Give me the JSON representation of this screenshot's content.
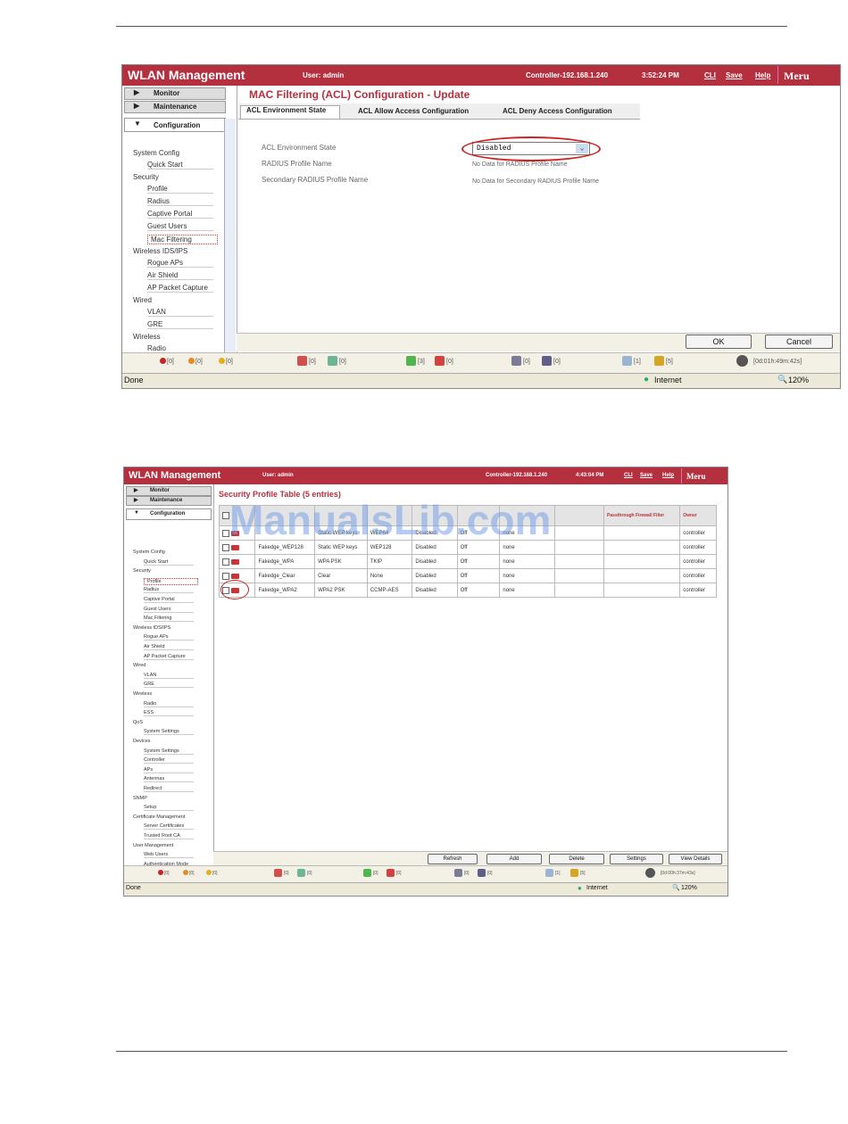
{
  "colors": {
    "accent": "#b5303f",
    "watermark": "#78a0e6"
  },
  "screenshot1": {
    "app_title": "WLAN Management",
    "user": "User: admin",
    "controller": "Controller-192.168.1.240",
    "time": "3:52:24 PM",
    "links": [
      "CLI",
      "Save",
      "Help"
    ],
    "logo": "Meru",
    "nav": {
      "monitor": "Monitor",
      "maintenance": "Maintenance",
      "configuration": "Configuration",
      "items": [
        {
          "label": "System Config",
          "group": true
        },
        {
          "label": "Quick Start"
        },
        {
          "label": "Security",
          "group": true
        },
        {
          "label": "Profile"
        },
        {
          "label": "Radius"
        },
        {
          "label": "Captive Portal"
        },
        {
          "label": "Guest Users"
        },
        {
          "label": "Mac Filtering",
          "selected": true
        },
        {
          "label": "Wireless IDS/IPS",
          "group": true
        },
        {
          "label": "Rogue APs"
        },
        {
          "label": "Air Shield"
        },
        {
          "label": "AP Packet Capture"
        },
        {
          "label": "Wired",
          "group": true
        },
        {
          "label": "VLAN"
        },
        {
          "label": "GRE"
        },
        {
          "label": "Wireless",
          "group": true
        },
        {
          "label": "Radio"
        }
      ]
    },
    "page_title": "MAC Filtering (ACL) Configuration - Update",
    "tabs": [
      "ACL Environment State",
      "ACL Allow Access Configuration",
      "ACL Deny Access Configuration"
    ],
    "form": {
      "acl_state_label": "ACL Environment State",
      "acl_state_value": "Disabled",
      "radius_label": "RADIUS Profile Name",
      "radius_value": "No Data for RADIUS Profile Name",
      "sec_radius_label": "Secondary RADIUS Profile Name",
      "sec_radius_value": "No Data for Secondary RADIUS Profile Name"
    },
    "ok_button": "OK",
    "cancel_button": "Cancel",
    "alarms": [
      "[0]",
      "[0]",
      "[0]"
    ],
    "counters": [
      "[0]",
      "[0]",
      "[3]",
      "[0]",
      "[0]",
      "[0]",
      "[1]",
      "[5]"
    ],
    "uptime": "[0d:01h:49m:42s]",
    "ie_status": "Done",
    "ie_zone": "Internet",
    "ie_zoom": "120%"
  },
  "screenshot2": {
    "app_title": "WLAN Management",
    "user": "User: admin",
    "controller": "Controller-192.168.1.240",
    "time": "4:43:04 PM",
    "links": [
      "CLI",
      "Save",
      "Help"
    ],
    "logo": "Meru",
    "nav": {
      "monitor": "Monitor",
      "maintenance": "Maintenance",
      "configuration": "Configuration",
      "items": [
        {
          "label": "System Config",
          "group": true
        },
        {
          "label": "Quick Start"
        },
        {
          "label": "Security",
          "group": true
        },
        {
          "label": "Profile",
          "selected": true
        },
        {
          "label": "Radius"
        },
        {
          "label": "Captive Portal"
        },
        {
          "label": "Guest Users"
        },
        {
          "label": "Mac Filtering"
        },
        {
          "label": "Wireless IDS/IPS",
          "group": true
        },
        {
          "label": "Rogue APs"
        },
        {
          "label": "Air Shield"
        },
        {
          "label": "AP Packet Capture"
        },
        {
          "label": "Wired",
          "group": true
        },
        {
          "label": "VLAN"
        },
        {
          "label": "GRE"
        },
        {
          "label": "Wireless",
          "group": true
        },
        {
          "label": "Radio"
        },
        {
          "label": "ESS"
        },
        {
          "label": "QoS",
          "group": true
        },
        {
          "label": "System Settings"
        },
        {
          "label": "Devices",
          "group": true
        },
        {
          "label": "System Settings"
        },
        {
          "label": "Controller"
        },
        {
          "label": "APs"
        },
        {
          "label": "Antennas"
        },
        {
          "label": "Redirect"
        },
        {
          "label": "SNMP",
          "group": true
        },
        {
          "label": "Setup"
        },
        {
          "label": "Certificate Management",
          "group": true
        },
        {
          "label": "Server Certificates"
        },
        {
          "label": "Trusted Root CA"
        },
        {
          "label": "User Management",
          "group": true
        },
        {
          "label": "Web Users"
        },
        {
          "label": "Authentication Mode"
        }
      ]
    },
    "page_title": "Security Profile Table (5 entries)",
    "table": {
      "headers": [
        "",
        "",
        "",
        "",
        "",
        "",
        "",
        "",
        "",
        "Passthrough Firewall Filter",
        "Owner"
      ],
      "rows": [
        [
          "",
          "Static WEP keys",
          "WEP64",
          "Disabled",
          "Off",
          "none",
          "",
          "",
          "controller"
        ],
        [
          "Fakedge_WEP128",
          "Static WEP keys",
          "WEP128",
          "Disabled",
          "Off",
          "none",
          "",
          "",
          "controller"
        ],
        [
          "Fakedge_WPA",
          "WPA PSK",
          "TKIP",
          "Disabled",
          "Off",
          "none",
          "",
          "",
          "controller"
        ],
        [
          "Fakedge_Clear",
          "Clear",
          "None",
          "Disabled",
          "Off",
          "none",
          "",
          "",
          "controller"
        ],
        [
          "Fakedge_WPA2",
          "WPA2 PSK",
          "CCMP-AES",
          "Disabled",
          "Off",
          "none",
          "",
          "",
          "controller"
        ]
      ]
    },
    "buttons": [
      "Refresh",
      "Add",
      "Delete",
      "Settings",
      "View Details"
    ],
    "alarms": [
      "[0]",
      "[0]",
      "[0]"
    ],
    "counters": [
      "[0]",
      "[0]",
      "[0]",
      "[0]",
      "[0]",
      "[0]",
      "[1]",
      "[5]"
    ],
    "uptime": "[0d:00h:37m:43s]",
    "ie_status": "Done",
    "ie_zone": "Internet",
    "ie_zoom": "120%"
  },
  "watermark": "ManualsLib.com"
}
